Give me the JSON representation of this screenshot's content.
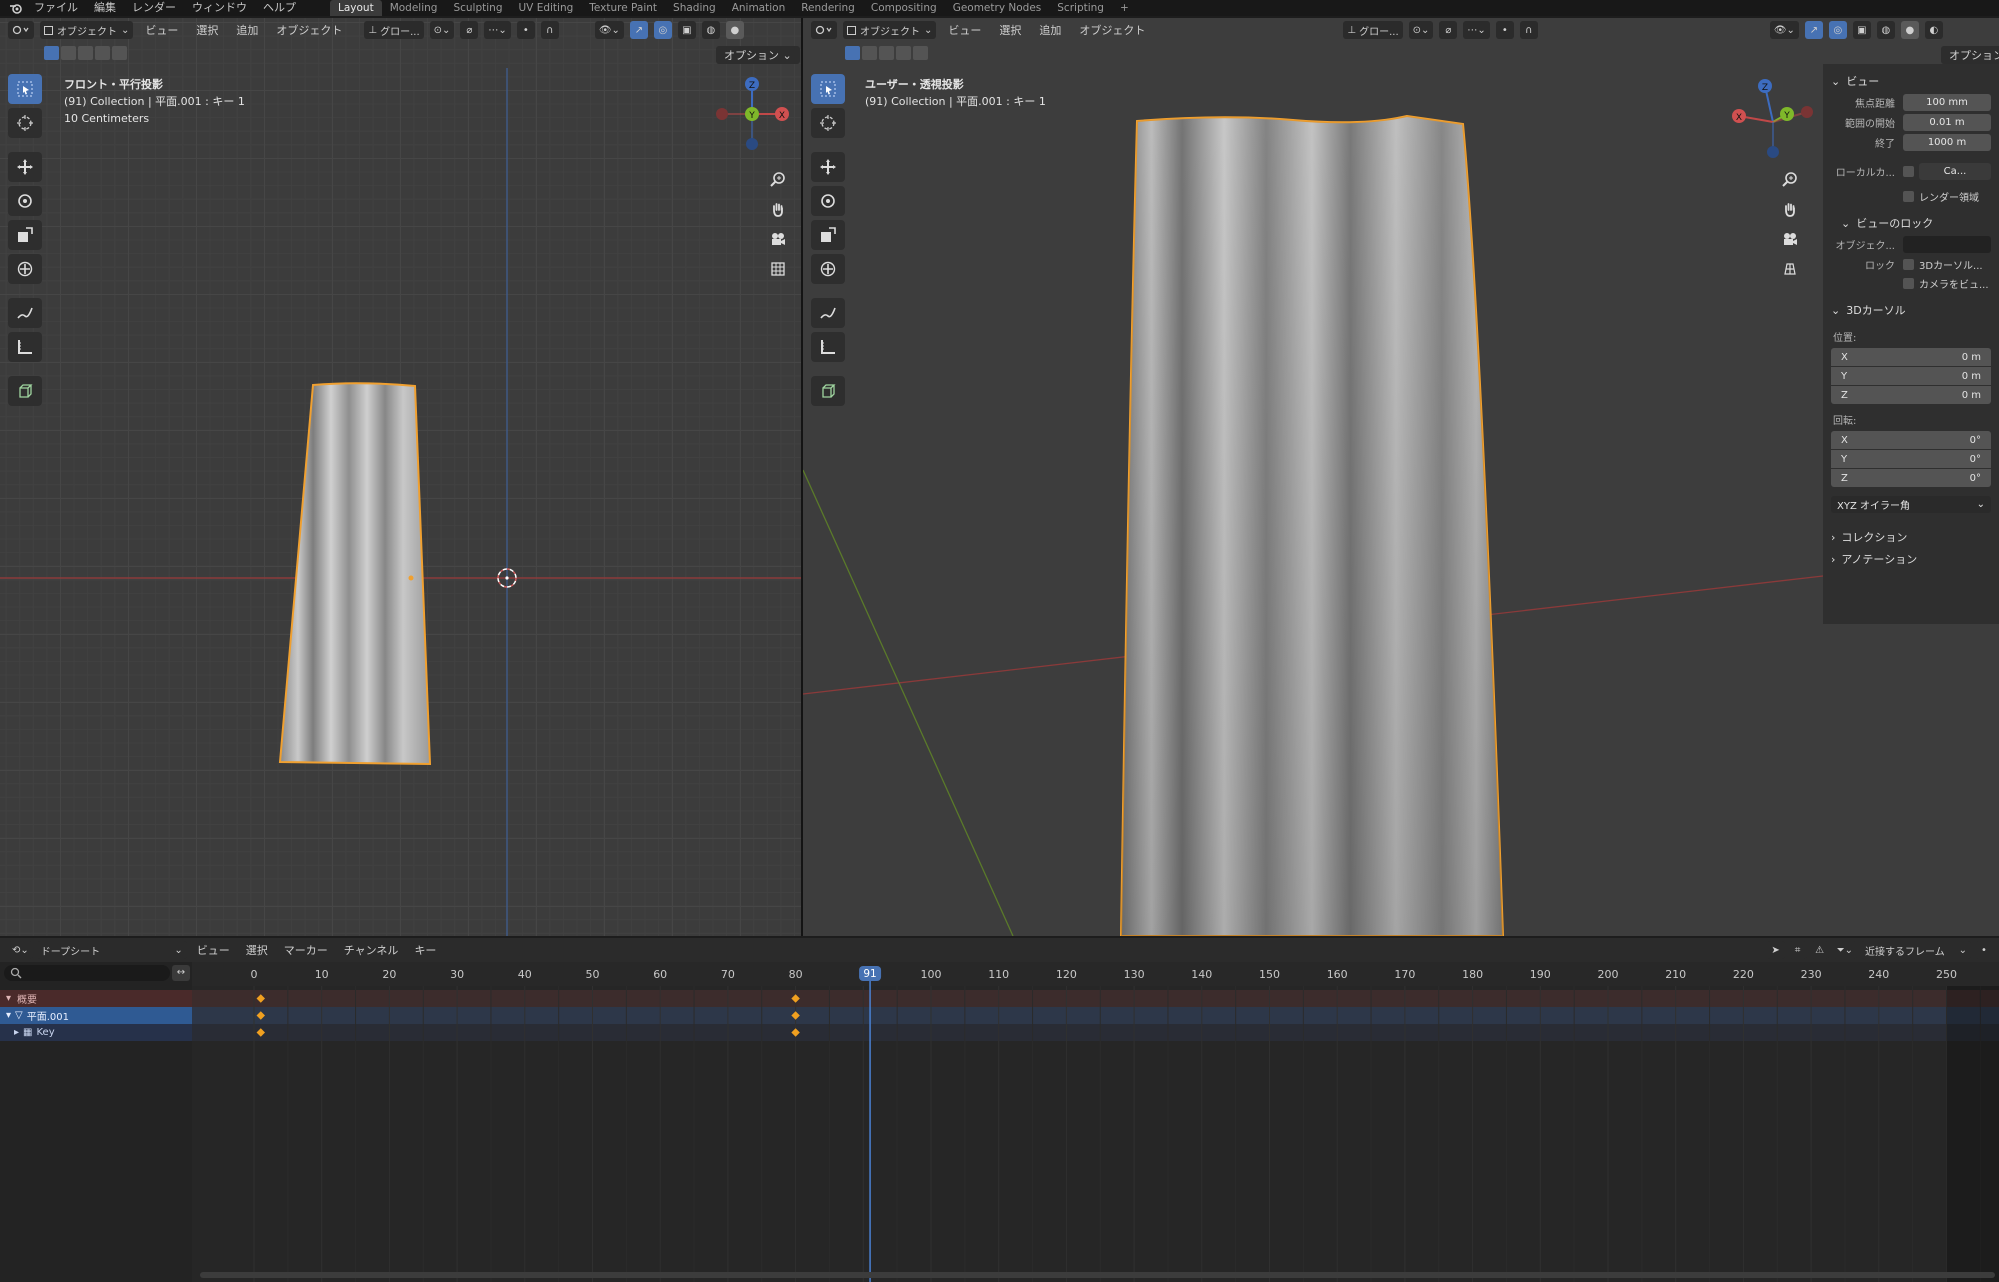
{
  "topbar": {
    "menus": [
      "ファイル",
      "編集",
      "レンダー",
      "ウィンドウ",
      "ヘルプ"
    ],
    "workspaces": [
      "Layout",
      "Modeling",
      "Sculpting",
      "UV Editing",
      "Texture Paint",
      "Shading",
      "Animation",
      "Rendering",
      "Compositing",
      "Geometry Nodes",
      "Scripting"
    ],
    "active_workspace": "Layout",
    "add_tab": "+"
  },
  "left_view": {
    "mode": "オブジェクト",
    "menus": [
      "ビュー",
      "選択",
      "追加",
      "オブジェクト"
    ],
    "transform_orientation": "グロー...",
    "options": "オプション",
    "info_title": "フロント・平行投影",
    "info_collection": "(91) Collection | 平面.001 : キー 1",
    "info_scale": "10 Centimeters",
    "gizmo": {
      "z": "Z",
      "y": "Y",
      "x": "X"
    }
  },
  "right_view": {
    "mode": "オブジェクト",
    "menus": [
      "ビュー",
      "選択",
      "追加",
      "オブジェクト"
    ],
    "transform_orientation": "グロー...",
    "options": "オプション",
    "info_title": "ユーザー・透視投影",
    "info_collection": "(91) Collection | 平面.001 : キー 1",
    "gizmo": {
      "z": "Z",
      "y": "Y",
      "x": "X"
    }
  },
  "npanel": {
    "view_header": "ビュー",
    "focal_label": "焦点距離",
    "focal_value": "100 mm",
    "clip_start_label": "範囲の開始",
    "clip_start_value": "0.01 m",
    "clip_end_label": "終了",
    "clip_end_value": "1000 m",
    "local_camera_label": "ローカルカ...",
    "local_camera_value": "Ca...",
    "render_region": "レンダー領域",
    "view_lock_header": "ビューのロック",
    "lock_object_label": "オブジェク...",
    "lock_label": "ロック",
    "lock_3dcursor": "3Dカーソル...",
    "lock_camera": "カメラをビュ...",
    "cursor_header": "3Dカーソル",
    "location_label": "位置:",
    "loc_x": "0 m",
    "loc_y": "0 m",
    "loc_z": "0 m",
    "rotation_label": "回転:",
    "rot_x": "0°",
    "rot_y": "0°",
    "rot_z": "0°",
    "axis_x": "X",
    "axis_y": "Y",
    "axis_z": "Z",
    "rotation_mode": "XYZ オイラー角",
    "collection_header": "コレクション",
    "annotation_header": "アノテーション"
  },
  "dopesheet": {
    "mode": "ドープシート",
    "menus": [
      "ビュー",
      "選択",
      "マーカー",
      "チャンネル",
      "キー"
    ],
    "snap": "近接するフレーム",
    "current_frame": "91",
    "frame_ticks": [
      "0",
      "10",
      "20",
      "30",
      "40",
      "50",
      "60",
      "70",
      "80",
      "100",
      "110",
      "120",
      "130",
      "140",
      "150",
      "160",
      "170",
      "180",
      "190",
      "200",
      "210",
      "220",
      "230",
      "240",
      "250"
    ],
    "channels": {
      "summary": "概要",
      "object": "平面.001",
      "key": "Key"
    },
    "keyframes": [
      1,
      80
    ]
  }
}
